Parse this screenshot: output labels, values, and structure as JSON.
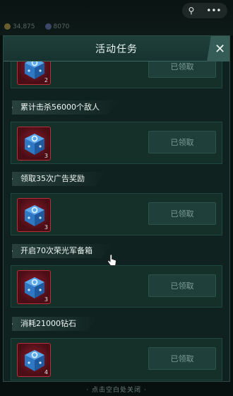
{
  "status": {
    "icons": [
      "pin-icon",
      "more-icon"
    ]
  },
  "resources": [
    "34,875",
    "8070"
  ],
  "panel": {
    "title": "活动任务",
    "close_glyph": "✕"
  },
  "tasks": [
    {
      "title": "",
      "qty": "2",
      "button": "已领取"
    },
    {
      "title": "累计击杀56000个敌人",
      "qty": "3",
      "button": "已领取"
    },
    {
      "title": "领取35次广告奖励",
      "qty": "3",
      "button": "已领取"
    },
    {
      "title": "开启70次荣光军备箱",
      "qty": "3",
      "button": "已领取"
    },
    {
      "title": "消耗21000钻石",
      "qty": "4",
      "button": "已领取"
    }
  ],
  "footer": {
    "hint": "· 点击空白处关闭 ·"
  },
  "colors": {
    "accent": "#355c57",
    "reward_border": "#b62e3a",
    "dice": "#3a8fd8"
  }
}
